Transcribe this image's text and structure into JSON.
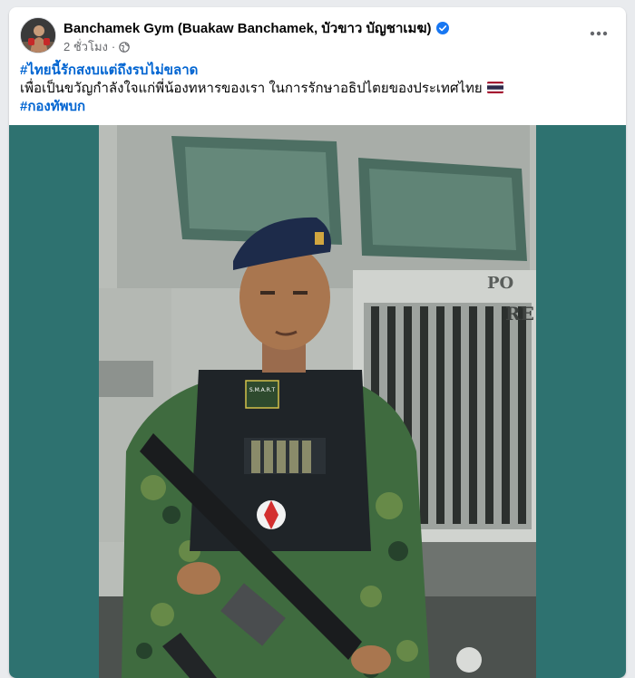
{
  "post": {
    "author": "Banchamek Gym (Buakaw Banchamek, บัวขาว บัญชาเมฆ)",
    "time": "2 ชั่วโมง",
    "separator": "·",
    "more_label": "•••",
    "lines": [
      "#ไทยนี้รักสงบแต่ถึงรบไม่ขลาด",
      "เพื่อเป็นขวัญกำลังใจแก่พี่น้องทหารของเรา ในการรักษาอธิปไตยของประเทศไทย",
      "#กองทัพบก"
    ],
    "flag_emoji": "thailand-flag-icon"
  },
  "photo": {
    "vest_patch": "S.M.A.R.T",
    "vehicle_letters_1": "PO",
    "vehicle_letters_2": "RE"
  },
  "colors": {
    "link": "#0064d1",
    "photo_bg": "#2e7270",
    "verified": "#1877f2"
  }
}
